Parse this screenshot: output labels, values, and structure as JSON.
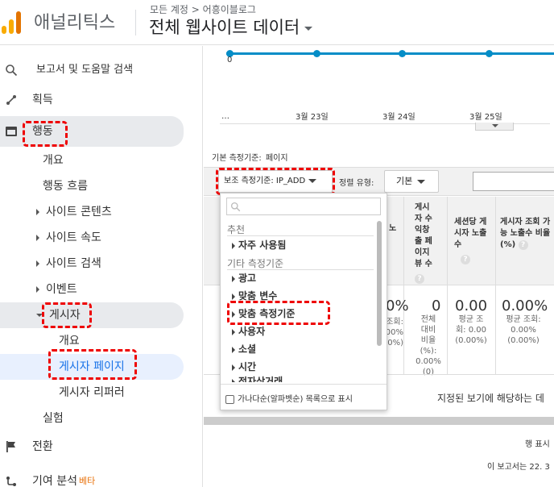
{
  "header": {
    "app_name": "애널리틱스",
    "breadcrumb": "모든 계정 > 어흥이블로그",
    "view_title": "전체 웹사이트 데이터",
    "logo_colors": [
      "#f9ab00",
      "#e37400"
    ]
  },
  "sidebar": {
    "search_label": "보고서 및 도움말 검색",
    "acquisition": "획득",
    "behavior": "행동",
    "overview": "개요",
    "behavior_flow": "행동 흐름",
    "site_content": "사이트 콘텐츠",
    "site_speed": "사이트 속도",
    "site_search": "사이트 검색",
    "events": "이벤트",
    "publisher": "게시자",
    "publisher_overview": "개요",
    "publisher_pages": "게시자 페이지",
    "publisher_referrers": "게시자 리퍼러",
    "experiments": "실험",
    "conversions": "전환",
    "attribution": "기여 분석",
    "beta": "베타"
  },
  "timeline": {
    "start_value": "0",
    "ellipsis": "…",
    "dates": [
      "3월 23일",
      "3월 24일",
      "3월 25일"
    ]
  },
  "controls": {
    "primary_dimension_label": "기본 측정기준:",
    "primary_dimension_value": "페이지",
    "secondary_dimension": "보조 측정기준: IP_ADD",
    "sort_type_label": "정렬 유형:",
    "sort_type_value": "기본"
  },
  "table": {
    "partial_header": "노",
    "col_impressions": "게시자 수익창출 페이지뷰 수",
    "col_session_impressions": "세션당 게시자 노출수",
    "col_viewable_ratio": "게시자 조회 가능 노출수 비율 (%)",
    "partial_pct": "0%",
    "partial_sub_lines": [
      "조회:",
      ".00%",
      "0%)"
    ],
    "val_impressions": "0",
    "sub_impressions": [
      "전체",
      "대비",
      "비율",
      "(%):",
      "0.00%",
      "(0)"
    ],
    "val_session": "0.00",
    "sub_session": [
      "평균 조",
      "회: 0.00",
      "(0.00%)"
    ],
    "val_ratio": "0.00%",
    "sub_ratio": [
      "평균 조회:",
      "0.00%",
      "(0.00%)"
    ],
    "no_data_message": "지정된 보기에 해당하는 데",
    "rows_label": "행 표시",
    "report_created": "이 보고서는 22. 3"
  },
  "dropdown": {
    "search_placeholder": "",
    "group_recommended": "추천",
    "item_frequent": "자주 사용됨",
    "group_other": "기타 측정기준",
    "items": [
      "광고",
      "맞춤 변수",
      "맞춤 측정기준",
      "사용자",
      "소셜",
      "시간",
      "전자상거래"
    ],
    "alphabetical_label": "가나다순(알파벳순) 목록으로 표시"
  }
}
